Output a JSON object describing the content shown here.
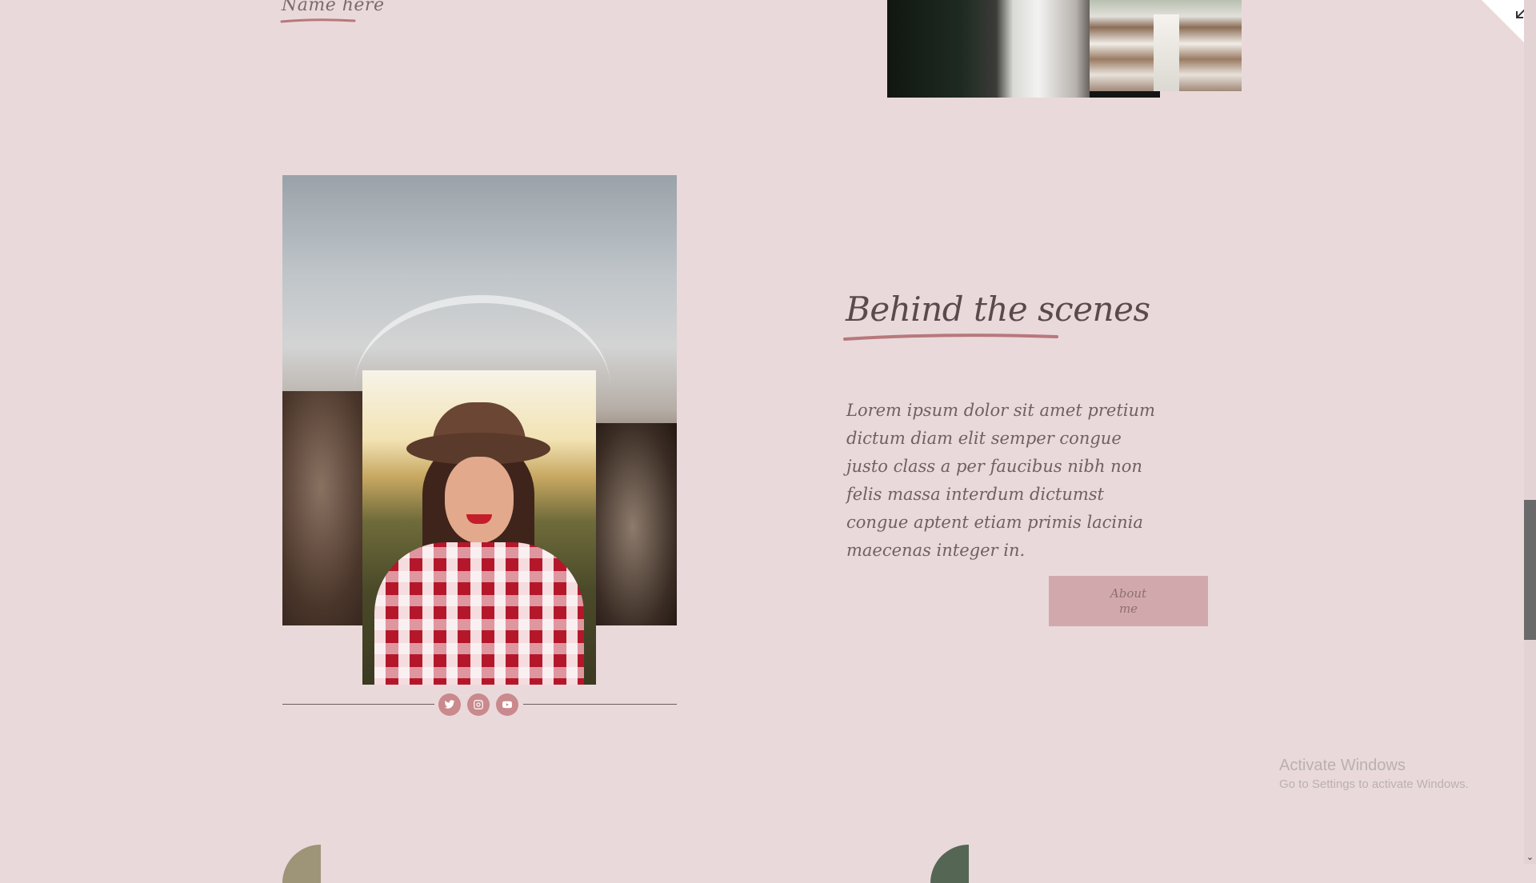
{
  "top": {
    "name_label": "Name here"
  },
  "section": {
    "heading": "Behind the scenes",
    "body": "Lorem ipsum dolor sit amet pretium dictum diam elit semper congue justo class a per faucibus nibh non felis massa interdum dictumst congue aptent etiam primis lacinia maecenas integer in.",
    "button_label": "About me"
  },
  "social": {
    "icons": [
      "twitter-icon",
      "instagram-icon",
      "youtube-icon"
    ]
  },
  "watermark": {
    "title": "Activate Windows",
    "subtitle": "Go to Settings to activate Windows."
  },
  "colors": {
    "background": "#ead9da",
    "accent": "#c9898d",
    "button": "#d1a9ac",
    "heading_text": "#5b4a4c"
  },
  "scrollbar": {
    "down_arrow": "⌄"
  }
}
